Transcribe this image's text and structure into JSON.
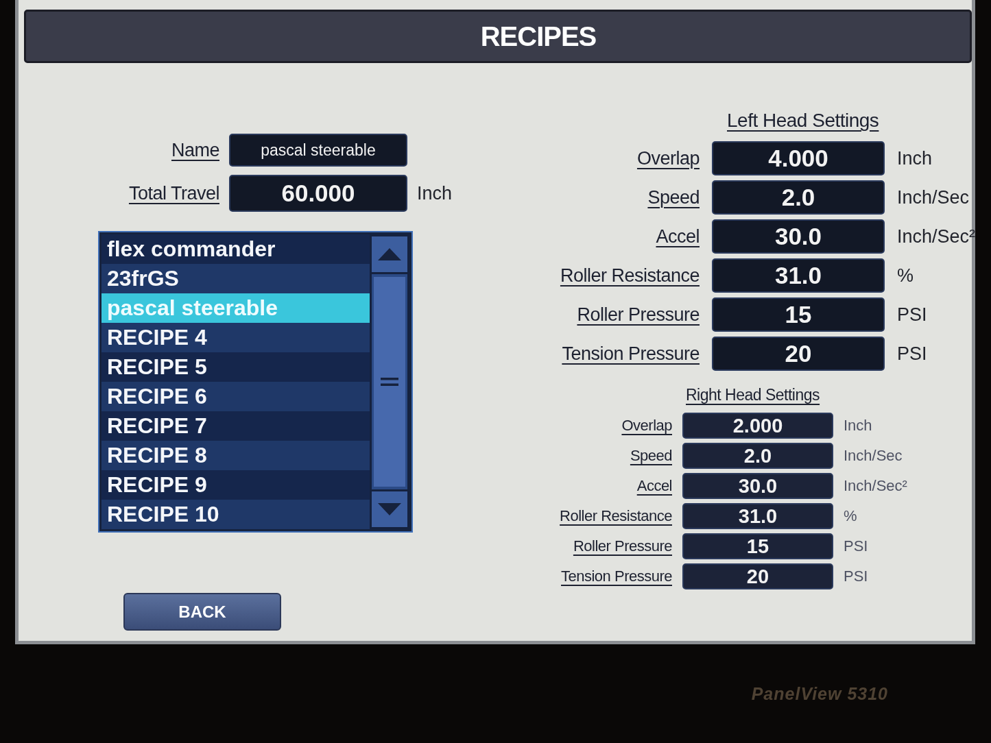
{
  "window": {
    "title": "RECIPES"
  },
  "form": [
    {
      "kind": "text",
      "label": "Name",
      "value": "pascal steerable"
    },
    {
      "kind": "number",
      "label": "Total Travel",
      "value": "60.000",
      "unit": "Inch"
    }
  ],
  "recipe_list": {
    "items": [
      {
        "label": "flex commander",
        "selected": false
      },
      {
        "label": "23frGS",
        "selected": false
      },
      {
        "label": "pascal steerable",
        "selected": true
      },
      {
        "label": "RECIPE 4",
        "selected": false
      },
      {
        "label": "RECIPE 5",
        "selected": false
      },
      {
        "label": "RECIPE 6",
        "selected": false
      },
      {
        "label": "RECIPE 7",
        "selected": false
      },
      {
        "label": "RECIPE 8",
        "selected": false
      },
      {
        "label": "RECIPE 9",
        "selected": false
      },
      {
        "label": "RECIPE 10",
        "selected": false
      }
    ]
  },
  "left_head": {
    "title": "Left Head Settings",
    "rows": [
      {
        "label": "Overlap",
        "value": "4.000",
        "unit": "Inch"
      },
      {
        "label": "Speed",
        "value": "2.0",
        "unit": "Inch/Sec"
      },
      {
        "label": "Accel",
        "value": "30.0",
        "unit": "Inch/Sec²"
      },
      {
        "label": "Roller Resistance",
        "value": "31.0",
        "unit": "%"
      },
      {
        "label": "Roller Pressure",
        "value": "15",
        "unit": "PSI"
      },
      {
        "label": "Tension Pressure",
        "value": "20",
        "unit": "PSI"
      }
    ]
  },
  "right_head": {
    "title": "Right Head Settings",
    "rows": [
      {
        "label": "Overlap",
        "value": "2.000",
        "unit": "Inch"
      },
      {
        "label": "Speed",
        "value": "2.0",
        "unit": "Inch/Sec"
      },
      {
        "label": "Accel",
        "value": "30.0",
        "unit": "Inch/Sec²"
      },
      {
        "label": "Roller Resistance",
        "value": "31.0",
        "unit": "%"
      },
      {
        "label": "Roller Pressure",
        "value": "15",
        "unit": "PSI"
      },
      {
        "label": "Tension Pressure",
        "value": "20",
        "unit": "PSI"
      }
    ]
  },
  "back_button": {
    "label": "BACK"
  },
  "device": {
    "model": "PanelView 5310"
  }
}
